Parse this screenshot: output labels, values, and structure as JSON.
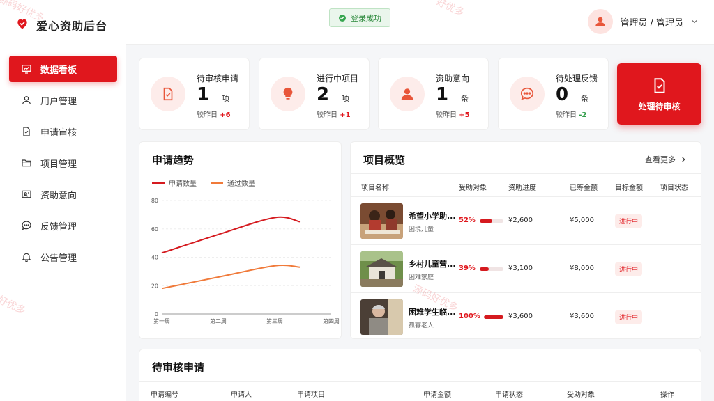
{
  "brand": {
    "title": "爱心资助后台"
  },
  "nav": [
    {
      "label": "数据看板",
      "icon": "dashboard-icon",
      "active": true
    },
    {
      "label": "用户管理",
      "icon": "user-icon"
    },
    {
      "label": "申请审核",
      "icon": "document-check-icon"
    },
    {
      "label": "项目管理",
      "icon": "folder-icon"
    },
    {
      "label": "资助意向",
      "icon": "id-card-icon"
    },
    {
      "label": "反馈管理",
      "icon": "chat-icon"
    },
    {
      "label": "公告管理",
      "icon": "bell-icon"
    }
  ],
  "toast": {
    "text": "登录成功"
  },
  "user": {
    "name": "管理员 / 管理员"
  },
  "stats": [
    {
      "label": "待审核申请",
      "value": "1",
      "unit": "项",
      "cmp_label": "较昨日",
      "delta": "+6",
      "trend": "up",
      "icon": "document-check-icon"
    },
    {
      "label": "进行中项目",
      "value": "2",
      "unit": "项",
      "cmp_label": "较昨日",
      "delta": "+1",
      "trend": "up",
      "icon": "lightbulb-icon"
    },
    {
      "label": "资助意向",
      "value": "1",
      "unit": "条",
      "cmp_label": "较昨日",
      "delta": "+5",
      "trend": "up",
      "icon": "person-icon"
    },
    {
      "label": "待处理反馈",
      "value": "0",
      "unit": "条",
      "cmp_label": "较昨日",
      "delta": "-2",
      "trend": "down",
      "icon": "chat-icon"
    }
  ],
  "action": {
    "label": "处理待审核"
  },
  "trend": {
    "title": "申请趋势",
    "legend": [
      "申请数量",
      "通过数量"
    ]
  },
  "chart_data": {
    "type": "line",
    "categories": [
      "第一周",
      "第二周",
      "第三周",
      "第四周"
    ],
    "series": [
      {
        "name": "申请数量",
        "color": "#d51a1f",
        "values": [
          43,
          56,
          68,
          65
        ]
      },
      {
        "name": "通过数量",
        "color": "#f07a3a",
        "values": [
          18,
          26,
          34,
          33
        ]
      }
    ],
    "yticks": [
      0,
      20,
      40,
      60,
      80
    ],
    "ylim": [
      0,
      80
    ],
    "grid": true,
    "legend_position": "top-left"
  },
  "overview": {
    "title": "项目概览",
    "more": "查看更多",
    "columns": [
      "项目名称",
      "受助对象",
      "资助进度",
      "已筹金额",
      "目标金额",
      "项目状态"
    ],
    "rows": [
      {
        "name": "希望小学助...",
        "target": "困境儿童",
        "progress": "52%",
        "progress_value": 0.52,
        "raised": "¥2,600",
        "goal": "¥5,000",
        "status": "进行中"
      },
      {
        "name": "乡村儿童营...",
        "target": "困难家庭",
        "progress": "39%",
        "progress_value": 0.39,
        "raised": "¥3,100",
        "goal": "¥8,000",
        "status": "进行中"
      },
      {
        "name": "困难学生临...",
        "target": "孤寡老人",
        "progress": "100%",
        "progress_value": 1.0,
        "raised": "¥3,600",
        "goal": "¥3,600",
        "status": "进行中"
      }
    ]
  },
  "pending": {
    "title": "待审核申请",
    "columns": [
      "申请编号",
      "申请人",
      "申请项目",
      "申请金额",
      "申请状态",
      "受助对象",
      "操作"
    ]
  },
  "watermarks": [
    "源码好优多",
    "好优多",
    "源码好优多",
    "好优多"
  ]
}
